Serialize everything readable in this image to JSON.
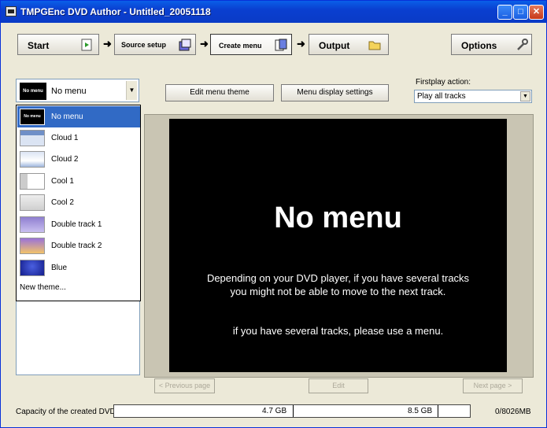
{
  "window": {
    "title": "TMPGEnc DVD Author - Untitled_20051118",
    "min_glyph": "_",
    "max_glyph": "□",
    "close_glyph": "✕"
  },
  "steps": {
    "start": "Start",
    "source_setup": "Source setup",
    "create_menu": "Create menu",
    "output": "Output",
    "options": "Options",
    "arrow": "➜"
  },
  "menu_theme": {
    "selected": "No menu",
    "thumb_text": "No menu",
    "drop_glyph": "▼",
    "items": [
      {
        "label": "No menu",
        "thumb": "No menu"
      },
      {
        "label": "Cloud 1"
      },
      {
        "label": "Cloud 2"
      },
      {
        "label": "Cool 1"
      },
      {
        "label": "Cool 2"
      },
      {
        "label": "Double track 1"
      },
      {
        "label": "Double track 2"
      },
      {
        "label": "Blue"
      }
    ],
    "new_theme": "New theme..."
  },
  "buttons": {
    "edit_menu_theme": "Edit menu theme",
    "menu_display_settings": "Menu display settings"
  },
  "firstplay": {
    "label": "Firstplay action:",
    "value": "Play all tracks",
    "drop_glyph": "▼"
  },
  "preview": {
    "heading": "No menu",
    "message_line1": "Depending on your DVD player, if you have several tracks",
    "message_line2": "you might not be able to move to the next track.",
    "message_line3": "if you have several tracks, please use a menu."
  },
  "nav": {
    "previous": "< Previous page",
    "edit": "Edit",
    "next": "Next page >"
  },
  "capacity": {
    "label": "Capacity of the created DVD:",
    "mark1": "4.7 GB",
    "mark2": "8.5 GB",
    "usage": "0/8026MB"
  },
  "colors": {
    "selection": "#316ac5",
    "titlebar": "#0a3fd0",
    "preview_bg": "#000000"
  }
}
